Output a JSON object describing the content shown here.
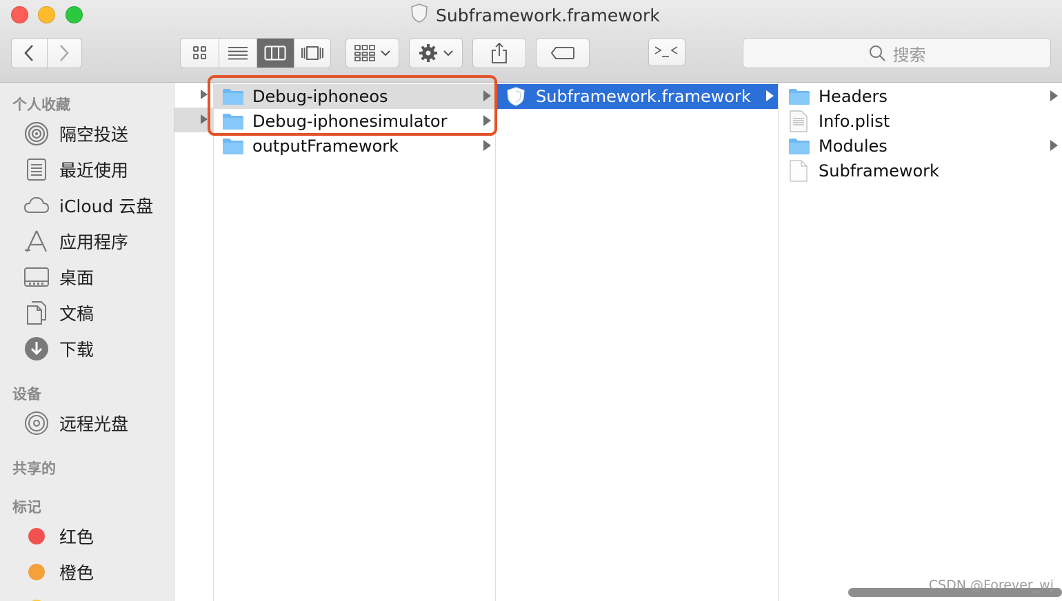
{
  "window": {
    "title": "Subframework.framework"
  },
  "toolbar": {
    "search_placeholder": "搜索"
  },
  "sidebar": {
    "favorites_title": "个人收藏",
    "favorites": [
      {
        "label": "隔空投送",
        "icon": "airdrop-icon"
      },
      {
        "label": "最近使用",
        "icon": "recents-icon"
      },
      {
        "label": "iCloud 云盘",
        "icon": "icloud-icon"
      },
      {
        "label": "应用程序",
        "icon": "applications-icon"
      },
      {
        "label": "桌面",
        "icon": "desktop-icon"
      },
      {
        "label": "文稿",
        "icon": "documents-icon"
      },
      {
        "label": "下载",
        "icon": "downloads-icon"
      }
    ],
    "devices_title": "设备",
    "devices": [
      {
        "label": "远程光盘",
        "icon": "remote-disc-icon"
      }
    ],
    "shared_title": "共享的",
    "tags_title": "标记",
    "tags": [
      {
        "label": "红色",
        "color": "#f2524f"
      },
      {
        "label": "橙色",
        "color": "#f4a13c"
      }
    ]
  },
  "columns": {
    "col1": [
      {
        "name": "Debug-iphoneos",
        "type": "folder",
        "selected": true,
        "has_children": true
      },
      {
        "name": "Debug-iphonesimulator",
        "type": "folder",
        "selected": false,
        "has_children": true
      },
      {
        "name": "outputFramework",
        "type": "folder",
        "selected": false,
        "has_children": true
      }
    ],
    "col2": [
      {
        "name": "Subframework.framework",
        "type": "framework",
        "selected": true,
        "has_children": true
      }
    ],
    "col3": [
      {
        "name": "Headers",
        "type": "folder",
        "has_children": true
      },
      {
        "name": "Info.plist",
        "type": "plist",
        "has_children": false
      },
      {
        "name": "Modules",
        "type": "folder",
        "has_children": true
      },
      {
        "name": "Subframework",
        "type": "file",
        "has_children": false
      }
    ]
  },
  "colors": {
    "selection_blue": "#2b6fd9",
    "annotation_red": "#e4532b",
    "folder_blue": "#6fb9f3"
  },
  "watermark": "CSDN @Forever_wj"
}
